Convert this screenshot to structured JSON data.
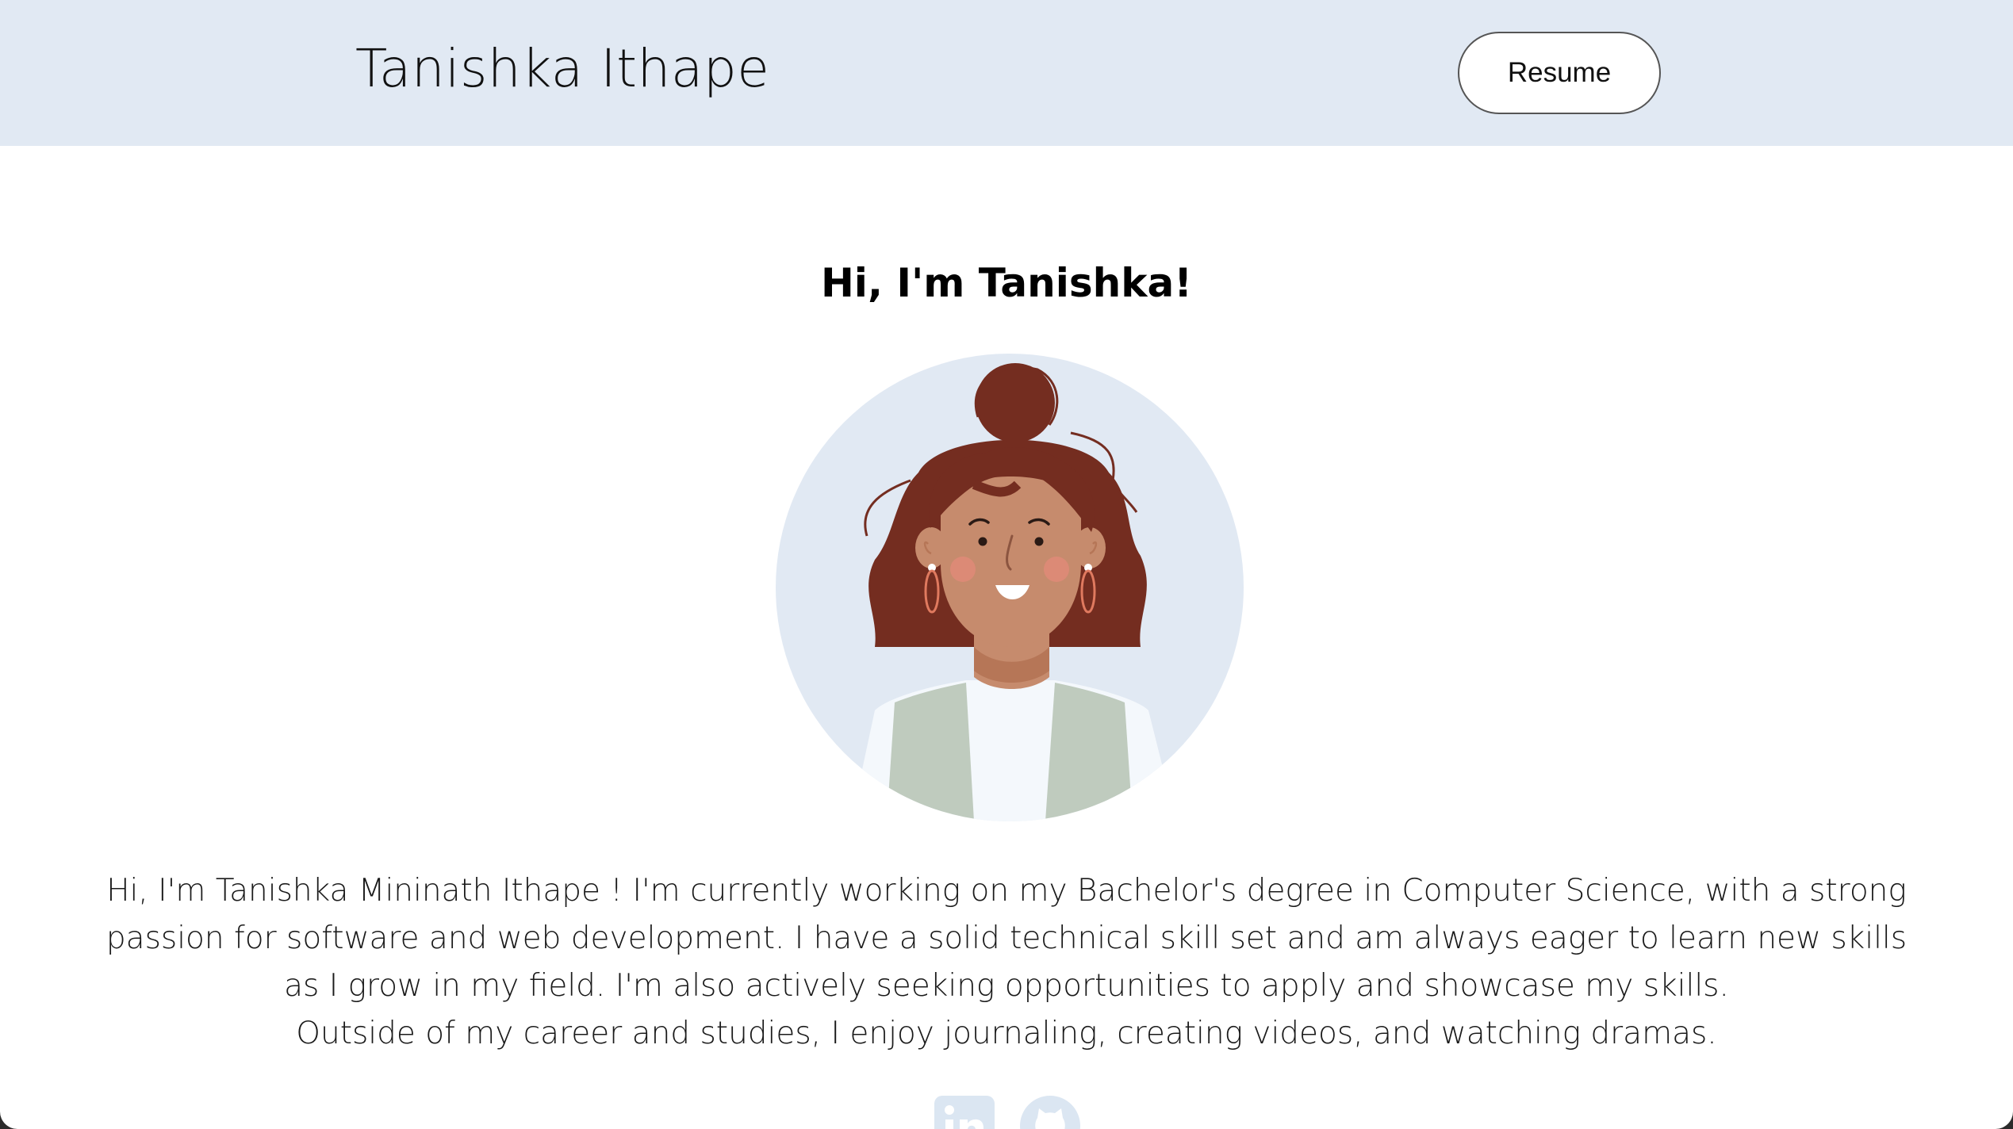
{
  "header": {
    "brand_name": "Tanishka Ithape",
    "resume_label": "Resume"
  },
  "hero": {
    "greeting": "Hi, I'm Tanishka!",
    "avatar_icon": "woman-avatar-illustration",
    "bio_paragraph_1": "Hi, I'm Tanishka Mininath Ithape ! I'm currently working on my Bachelor's degree in Computer Science, with a strong passion for software and web development. I have a solid technical skill set and am always eager to learn new skills as I grow in my field. I'm also actively seeking opportunities to apply and showcase my skills.",
    "bio_paragraph_2": "Outside of my career and studies, I enjoy journaling, creating videos, and watching dramas."
  },
  "socials": [
    {
      "icon": "linkedin-icon"
    },
    {
      "icon": "github-icon"
    }
  ],
  "colors": {
    "navbar_bg": "#e1e9f3",
    "avatar_bg": "#e1e9f3",
    "hair": "#742d20",
    "skin": "#c68b6d",
    "vest": "#bfcbbe",
    "icon_tint": "#dbe6f2"
  }
}
